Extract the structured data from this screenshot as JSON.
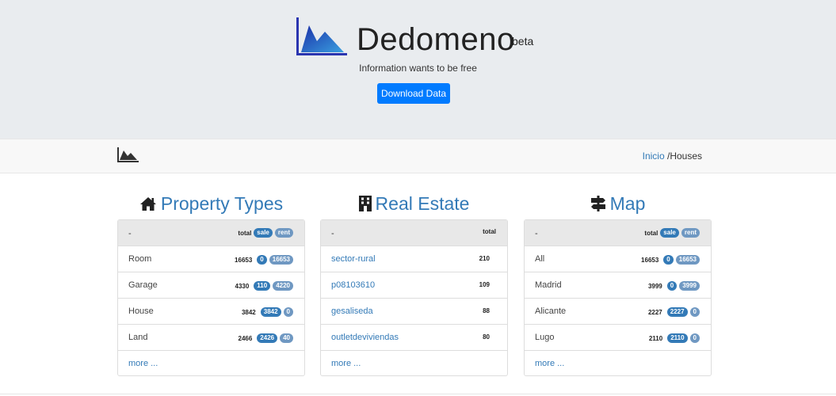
{
  "hero": {
    "brand": "Dedomeno",
    "beta": "beta",
    "tagline": "Information wants to be free",
    "download_label": "Download Data"
  },
  "navbar": {
    "breadcrumb_home": "Inicio",
    "breadcrumb_sep": " /",
    "breadcrumb_current": "Houses"
  },
  "property_types": {
    "title": "Property Types",
    "header": {
      "dash": "-",
      "total": "total",
      "sale": "sale",
      "rent": "rent"
    },
    "rows": [
      {
        "label": "Room",
        "total": "16653",
        "sale": "0",
        "rent": "16653"
      },
      {
        "label": "Garage",
        "total": "4330",
        "sale": "110",
        "rent": "4220"
      },
      {
        "label": "House",
        "total": "3842",
        "sale": "3842",
        "rent": "0"
      },
      {
        "label": "Land",
        "total": "2466",
        "sale": "2426",
        "rent": "40"
      }
    ],
    "more": "more ..."
  },
  "real_estate": {
    "title": "Real Estate",
    "header": {
      "dash": "-",
      "total": "total"
    },
    "rows": [
      {
        "label": "sector-rural",
        "total": "210"
      },
      {
        "label": "p08103610",
        "total": "109"
      },
      {
        "label": "gesaliseda",
        "total": "88"
      },
      {
        "label": "outletdeviviendas",
        "total": "80"
      }
    ],
    "more": "more ..."
  },
  "map": {
    "title": "Map",
    "header": {
      "dash": "-",
      "total": "total",
      "sale": "sale",
      "rent": "rent"
    },
    "rows": [
      {
        "label": "All",
        "total": "16653",
        "sale": "0",
        "rent": "16653"
      },
      {
        "label": "Madrid",
        "total": "3999",
        "sale": "0",
        "rent": "3999"
      },
      {
        "label": "Alicante",
        "total": "2227",
        "sale": "2227",
        "rent": "0"
      },
      {
        "label": "Lugo",
        "total": "2110",
        "sale": "2110",
        "rent": "0"
      }
    ],
    "more": "more ..."
  },
  "colors": {
    "accent": "#337ab7",
    "button": "#007bff",
    "sale_badge": "#337ab7",
    "rent_badge": "#6f98c2",
    "hero_bg": "#e9ecef"
  },
  "icons": {
    "logo": "mountain-chart-icon",
    "property_types": "home-icon",
    "real_estate": "building-icon",
    "map": "signpost-icon"
  }
}
